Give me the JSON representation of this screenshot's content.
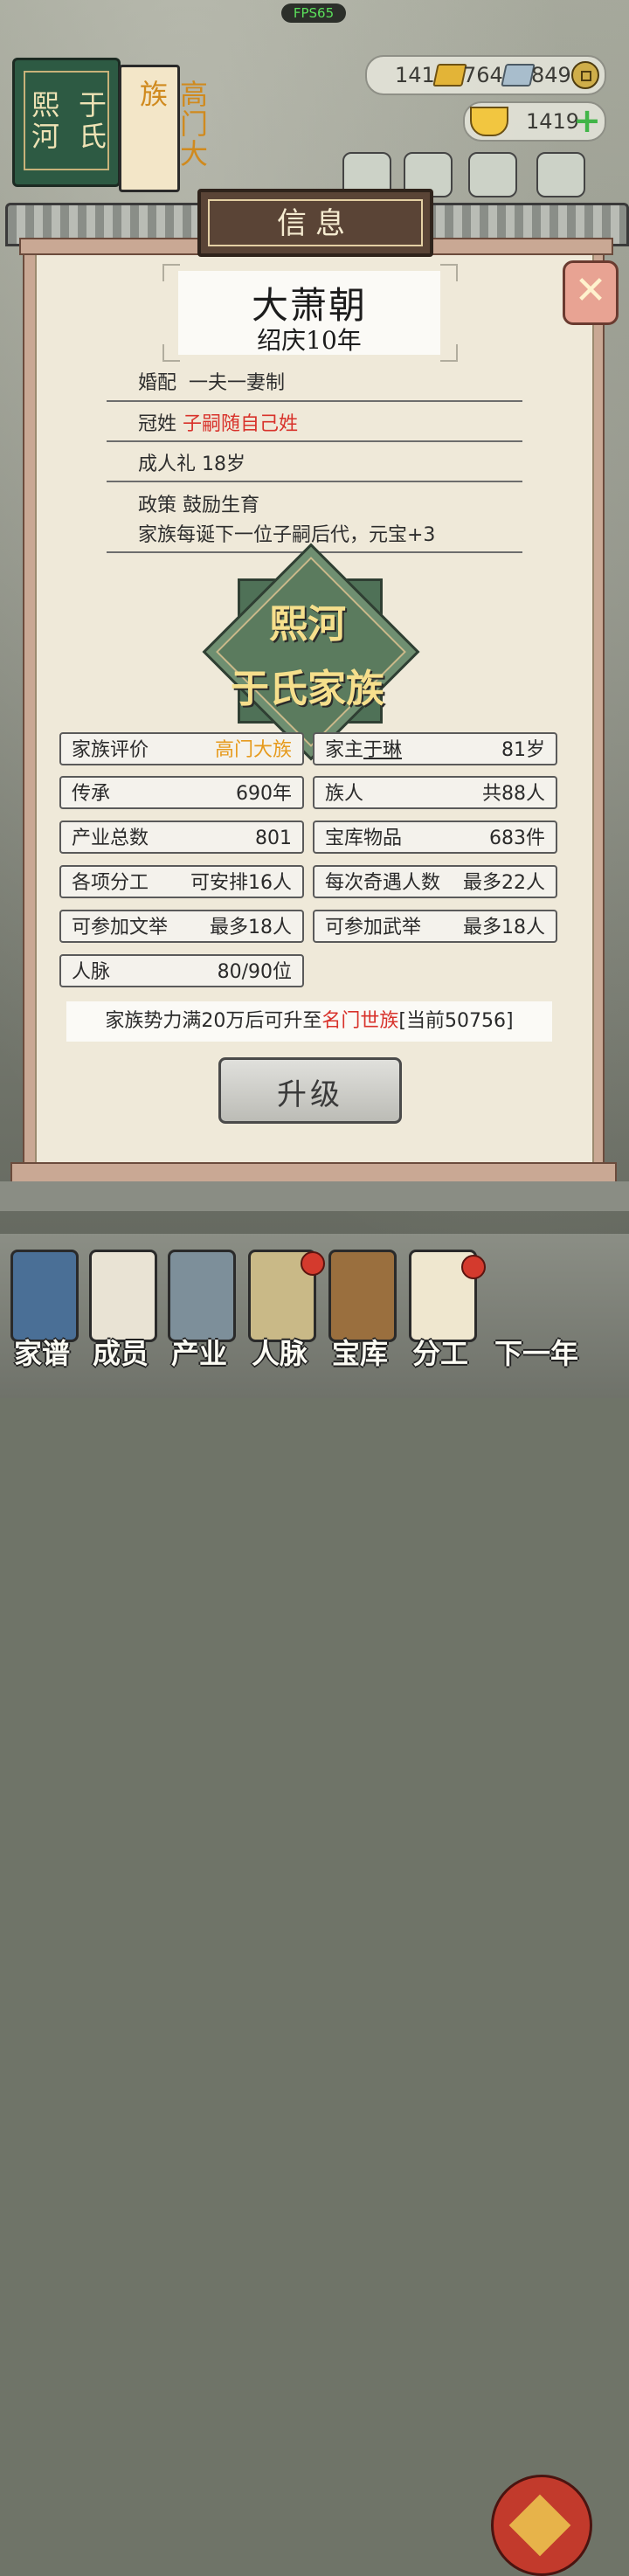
{
  "status": {
    "fps": "FPS65"
  },
  "header": {
    "book_title_left": "熙河",
    "book_title_right": "于氏",
    "rank_tag": "高门大族"
  },
  "resources": {
    "gold_bars": "141",
    "silver_bars": "764",
    "coins": "849",
    "ingots": "1419"
  },
  "dialog": {
    "title": "信息",
    "close_label": "✕",
    "dynasty": "大萧朝",
    "era": "绍庆10年",
    "rules": [
      {
        "label": "婚配",
        "value": "一夫一妻制"
      },
      {
        "label": "冠姓",
        "value": "子嗣随自己姓"
      },
      {
        "label": "成人礼",
        "value": "18岁"
      },
      {
        "label": "政策",
        "value": "鼓励生育",
        "note": "家族每诞下一位子嗣后代，元宝+3"
      }
    ],
    "emblem": {
      "line1": "熙河",
      "line2": "于氏家族"
    },
    "stats": [
      {
        "label": "家族评价",
        "value": "高门大族"
      },
      {
        "label": "家主",
        "name": "于琳",
        "value": "81岁"
      },
      {
        "label": "传承",
        "value": "690年"
      },
      {
        "label": "族人",
        "value": "共88人"
      },
      {
        "label": "产业总数",
        "value": "801"
      },
      {
        "label": "宝库物品",
        "value": "683件"
      },
      {
        "label": "各项分工",
        "value": "可安排16人"
      },
      {
        "label": "每次奇遇人数",
        "value": "最多22人"
      },
      {
        "label": "可参加文举",
        "value": "最多18人"
      },
      {
        "label": "可参加武举",
        "value": "最多18人"
      },
      {
        "label": "人脉",
        "value": "80/90位"
      }
    ],
    "notice": {
      "prefix": "家族势力满20万后可升至",
      "highlight": "名门世族",
      "suffix": "[当前50756]"
    },
    "upgrade_button": "升级"
  },
  "nav": [
    {
      "label": "家谱"
    },
    {
      "label": "成员"
    },
    {
      "label": "产业"
    },
    {
      "label": "人脉"
    },
    {
      "label": "宝库"
    },
    {
      "label": "分工"
    },
    {
      "label": "下一年"
    }
  ],
  "colors": {
    "highlight_red": "#d8322b",
    "highlight_orange": "#e69a1c",
    "panel_bg": "#efe9d9"
  }
}
